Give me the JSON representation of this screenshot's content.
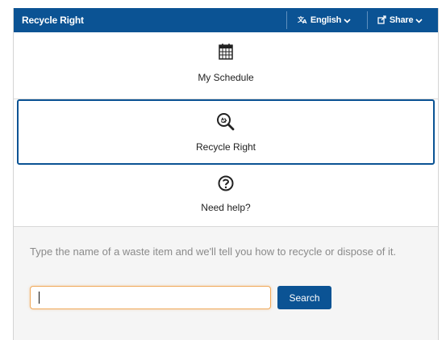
{
  "header": {
    "title": "Recycle Right",
    "language_label": "English",
    "share_label": "Share",
    "language_icon": "translate-icon",
    "share_icon": "share-icon"
  },
  "nav": {
    "items": [
      {
        "label": "My Schedule",
        "icon": "calendar-icon",
        "active": false
      },
      {
        "label": "Recycle Right",
        "icon": "recycle-search-icon",
        "active": true
      },
      {
        "label": "Need help?",
        "icon": "question-circle-icon",
        "active": false
      }
    ]
  },
  "search": {
    "instructions": "Type the name of a waste item and we'll tell you how to recycle or dispose of it.",
    "input_value": "",
    "placeholder": "",
    "button_label": "Search"
  },
  "colors": {
    "primary": "#0b5394",
    "input_focus_border": "#f0a95a",
    "instruction_text": "#8a8a8a",
    "section_background": "#f5f5f5"
  }
}
